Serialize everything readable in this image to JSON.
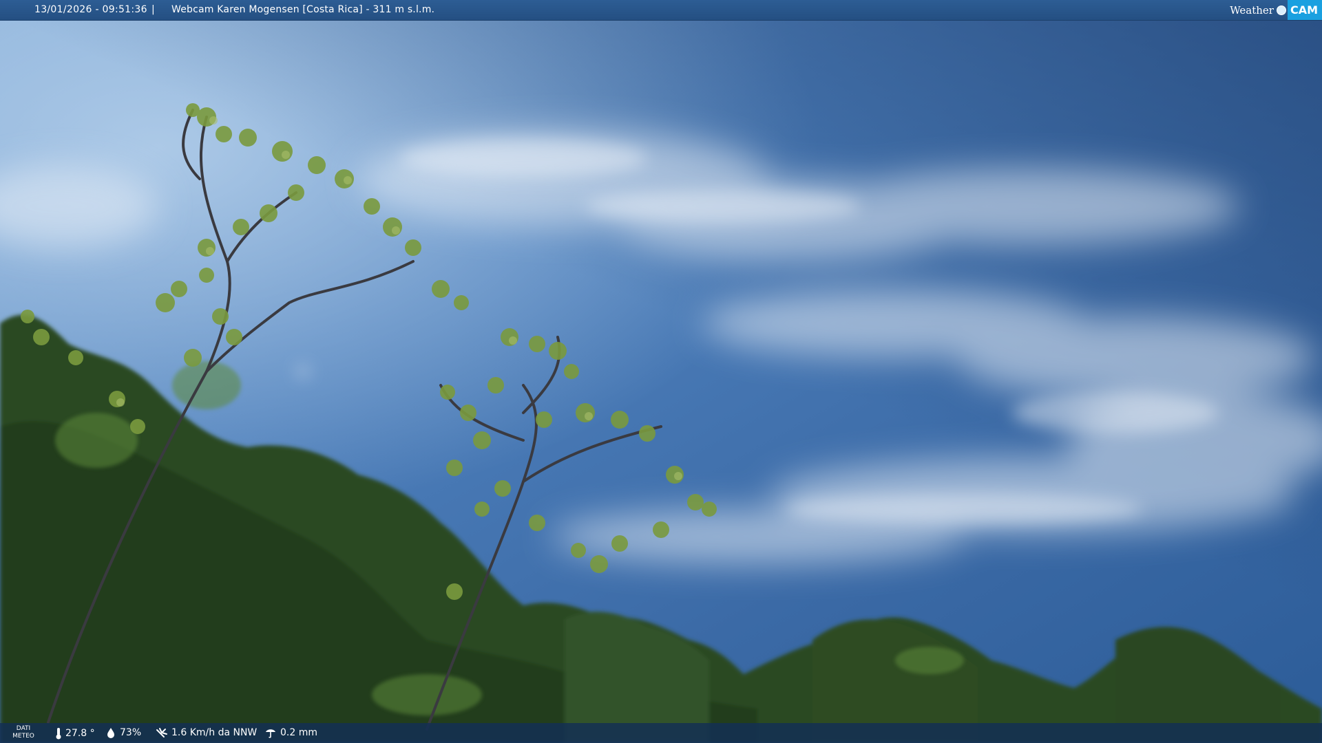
{
  "header": {
    "timestamp": "13/01/2026 - 09:51:36",
    "separator": "|",
    "title": "Webcam Karen Mogensen [Costa Rica] - 311 m s.l.m."
  },
  "logo": {
    "word": "Weather",
    "cam": "CAM"
  },
  "weather_bar": {
    "label_line1": "DATI",
    "label_line2": "METEO",
    "temperature": "27.8 °",
    "humidity": "73%",
    "wind": "1.6 Km/h da NNW",
    "rain": "0.2 mm",
    "icons": [
      "thermometer-icon",
      "humidity-drop-icon",
      "wind-icon",
      "rain-gauge-icon"
    ]
  },
  "scene": {
    "subject": "sky-with-cirrus-clouds-and-tree-canopy",
    "sky_color": "#4a7cb8",
    "foliage_color": "#2f4d22"
  }
}
